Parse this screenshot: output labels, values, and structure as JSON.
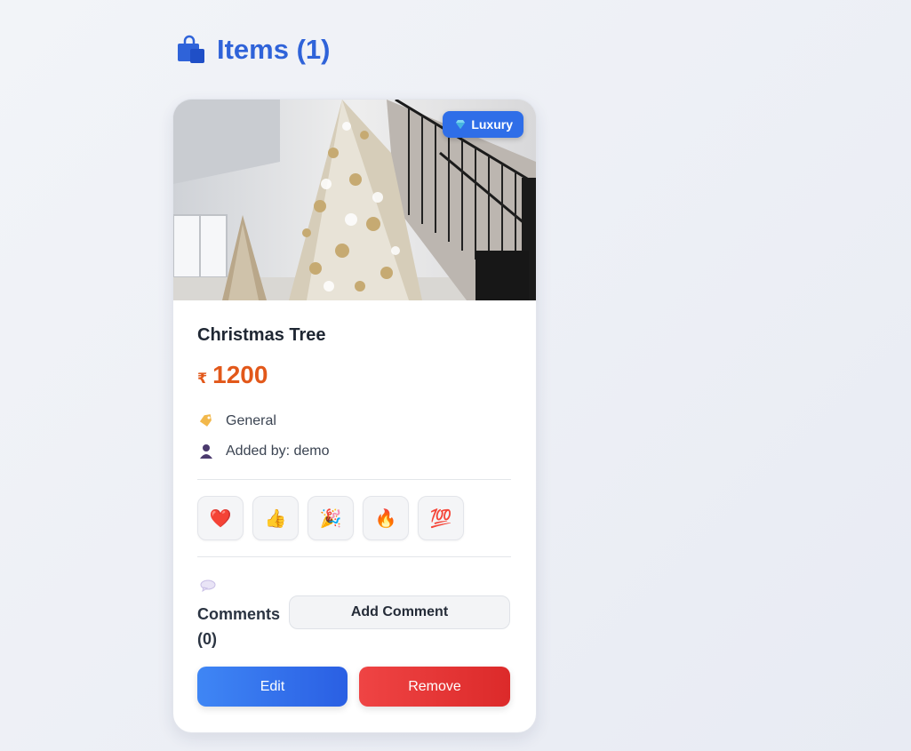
{
  "header": {
    "title": "Items (1)",
    "icon": "shopping-bag-icon"
  },
  "item": {
    "badge": {
      "label": "Luxury",
      "icon": "gem-icon",
      "color": "#2f6ee8"
    },
    "title": "Christmas Tree",
    "price": {
      "currency": "₹",
      "value": "1200",
      "color": "#e2581a"
    },
    "category": {
      "icon": "tag-icon",
      "text": "General"
    },
    "added_by": {
      "icon": "user-icon",
      "text": "Added by: demo"
    },
    "reactions": [
      {
        "emoji": "❤️",
        "name": "heart"
      },
      {
        "emoji": "👍",
        "name": "thumbs-up"
      },
      {
        "emoji": "🎉",
        "name": "party"
      },
      {
        "emoji": "🔥",
        "name": "fire"
      },
      {
        "emoji": "💯",
        "name": "hundred"
      }
    ],
    "comments": {
      "icon": "speech-bubble-icon",
      "label_line1": "Comments",
      "label_line2": "(0)",
      "add_label": "Add Comment"
    },
    "actions": {
      "edit_label": "Edit",
      "remove_label": "Remove",
      "edit_color": "#2f6ee8",
      "remove_color": "#e53535"
    }
  }
}
